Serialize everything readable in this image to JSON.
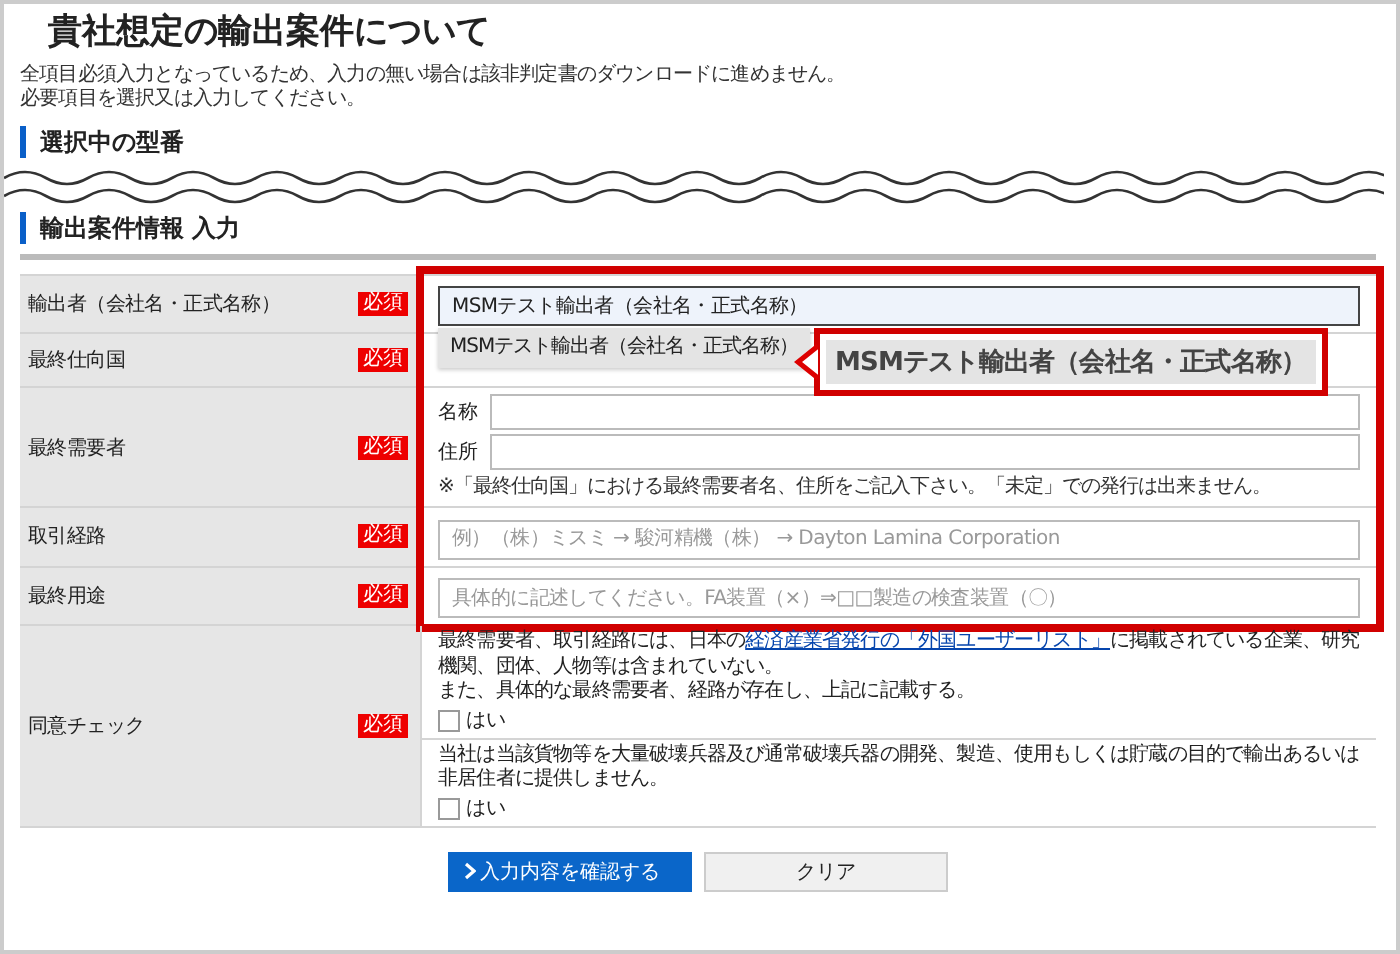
{
  "title": "貴社想定の輸出案件について",
  "notes": [
    "全項目必須入力となっているため、入力の無い場合は該非判定書のダウンロードに進めません。",
    "必要項目を選択又は入力してください。"
  ],
  "sections": [
    {
      "heading": "選択中の型番"
    },
    {
      "heading": "輸出案件情報 入力"
    }
  ],
  "rows": [
    {
      "label": "輸出者（会社名・正式名称）",
      "badge": "必須",
      "kind": "text",
      "value": "MSMテスト輸出者（会社名・正式名称）",
      "focused": true
    },
    {
      "label": "最終仕向国",
      "badge": "必須",
      "kind": "select"
    },
    {
      "label": "最終需要者",
      "badge": "必須",
      "kind": "name_address",
      "fields": [
        {
          "label": "名称"
        },
        {
          "label": "住所"
        }
      ],
      "note": "※「最終仕向国」における最終需要者名、住所をご記入下さい。「未定」での発行は出来ません。"
    },
    {
      "label": "取引経路",
      "badge": "必須",
      "kind": "text",
      "placeholder": "例）（株）ミスミ → 駿河精機（株） → Dayton Lamina Corporation",
      "focused": false
    },
    {
      "label": "最終用途",
      "badge": "必須",
      "kind": "text",
      "placeholder": "具体的に記述してください。FA装置（×）⇒□□製造の検査装置（〇）",
      "focused": false
    },
    {
      "label": "同意チェック",
      "badge": "必須",
      "kind": "consent",
      "items": [
        {
          "text_before": "最終需要者、取引経路には、日本の",
          "link": "経済産業省発行の「外国ユーザーリスト」",
          "text_after": "に掲載されている企業、研究機関、団体、人物等は含まれていない。",
          "text_line2": "また、具体的な最終需要者、経路が存在し、上記に記載する。",
          "checkbox_label": "はい",
          "checked": false
        },
        {
          "text_before": "当社は当該貨物等を大量破壊兵器及び通常破壊兵器の開発、製造、使用もしくは貯蔵の目的で輸出あるいは非居住者に提供しません。",
          "checkbox_label": "はい",
          "checked": false
        }
      ]
    }
  ],
  "dropdown": {
    "options": [
      {
        "label": "MSMテスト輸出者（会社名・正式名称）",
        "selected": true
      }
    ]
  },
  "callout": {
    "text": "MSMテスト輸出者（会社名・正式名称）"
  },
  "buttons": [
    {
      "label": "入力内容を確認する",
      "kind": "primary"
    },
    {
      "label": "クリア",
      "kind": "secondary"
    }
  ]
}
